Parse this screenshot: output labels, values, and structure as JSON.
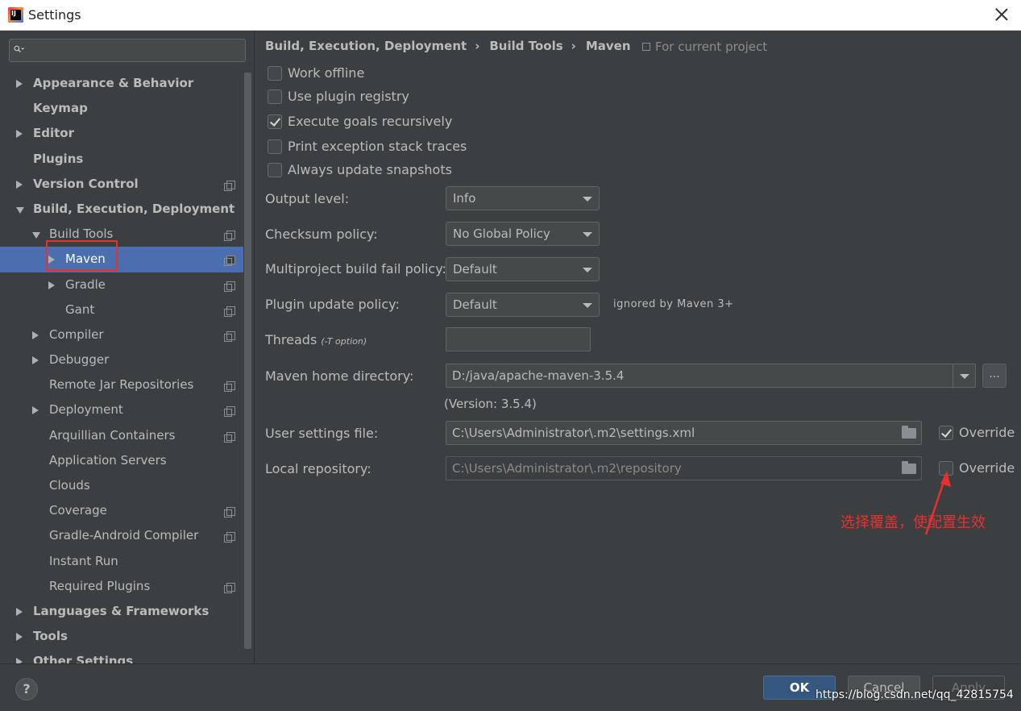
{
  "window": {
    "title": "Settings"
  },
  "sidebar": {
    "search_placeholder": "",
    "items": [
      {
        "label": "Appearance & Behavior",
        "bold": true,
        "arrow": "right",
        "indent": 0,
        "project": false
      },
      {
        "label": "Keymap",
        "bold": true,
        "arrow": "none",
        "indent": 0,
        "project": false
      },
      {
        "label": "Editor",
        "bold": true,
        "arrow": "right",
        "indent": 0,
        "project": false
      },
      {
        "label": "Plugins",
        "bold": true,
        "arrow": "none",
        "indent": 0,
        "project": false
      },
      {
        "label": "Version Control",
        "bold": true,
        "arrow": "right",
        "indent": 0,
        "project": true
      },
      {
        "label": "Build, Execution, Deployment",
        "bold": true,
        "arrow": "down",
        "indent": 0,
        "project": false
      },
      {
        "label": "Build Tools",
        "bold": false,
        "arrow": "down",
        "indent": 1,
        "project": true
      },
      {
        "label": "Maven",
        "bold": false,
        "arrow": "right",
        "indent": 2,
        "project": true,
        "selected": true
      },
      {
        "label": "Gradle",
        "bold": false,
        "arrow": "right",
        "indent": 2,
        "project": true
      },
      {
        "label": "Gant",
        "bold": false,
        "arrow": "none",
        "indent": 2,
        "project": true
      },
      {
        "label": "Compiler",
        "bold": false,
        "arrow": "right",
        "indent": 1,
        "project": true
      },
      {
        "label": "Debugger",
        "bold": false,
        "arrow": "right",
        "indent": 1,
        "project": false
      },
      {
        "label": "Remote Jar Repositories",
        "bold": false,
        "arrow": "none",
        "indent": 1,
        "project": true
      },
      {
        "label": "Deployment",
        "bold": false,
        "arrow": "right",
        "indent": 1,
        "project": true
      },
      {
        "label": "Arquillian Containers",
        "bold": false,
        "arrow": "none",
        "indent": 1,
        "project": true
      },
      {
        "label": "Application Servers",
        "bold": false,
        "arrow": "none",
        "indent": 1,
        "project": false
      },
      {
        "label": "Clouds",
        "bold": false,
        "arrow": "none",
        "indent": 1,
        "project": false
      },
      {
        "label": "Coverage",
        "bold": false,
        "arrow": "none",
        "indent": 1,
        "project": true
      },
      {
        "label": "Gradle-Android Compiler",
        "bold": false,
        "arrow": "none",
        "indent": 1,
        "project": true
      },
      {
        "label": "Instant Run",
        "bold": false,
        "arrow": "none",
        "indent": 1,
        "project": false
      },
      {
        "label": "Required Plugins",
        "bold": false,
        "arrow": "none",
        "indent": 1,
        "project": true
      },
      {
        "label": "Languages & Frameworks",
        "bold": true,
        "arrow": "right",
        "indent": 0,
        "project": false
      },
      {
        "label": "Tools",
        "bold": true,
        "arrow": "right",
        "indent": 0,
        "project": false
      },
      {
        "label": "Other Settings",
        "bold": true,
        "arrow": "right",
        "indent": 0,
        "project": false
      }
    ]
  },
  "main": {
    "breadcrumb": [
      "Build, Execution, Deployment",
      "Build Tools",
      "Maven"
    ],
    "breadcrumb_sep": "›",
    "for_current_project": "For current project",
    "checkboxes": [
      {
        "label": "Work offline",
        "checked": false
      },
      {
        "label": "Use plugin registry",
        "checked": false
      },
      {
        "label": "Execute goals recursively",
        "checked": true
      },
      {
        "label": "Print exception stack traces",
        "checked": false
      },
      {
        "label": "Always update snapshots",
        "checked": false
      }
    ],
    "output_level": {
      "label": "Output level:",
      "value": "Info"
    },
    "checksum_policy": {
      "label": "Checksum policy:",
      "value": "No Global Policy"
    },
    "multiproject_policy": {
      "label": "Multiproject build fail policy:",
      "value": "Default"
    },
    "plugin_update_policy": {
      "label": "Plugin update policy:",
      "value": "Default",
      "note": "ignored by Maven 3+"
    },
    "threads": {
      "label": "Threads",
      "hint": "(-T option)",
      "value": ""
    },
    "maven_home": {
      "label": "Maven home directory:",
      "value": "D:/java/apache-maven-3.5.4",
      "browse": "...",
      "version": "(Version: 3.5.4)"
    },
    "user_settings": {
      "label": "User settings file:",
      "value": "C:\\Users\\Administrator\\.m2\\settings.xml",
      "override_label": "Override",
      "override_checked": true
    },
    "local_repo": {
      "label": "Local repository:",
      "value": "C:\\Users\\Administrator\\.m2\\repository",
      "override_label": "Override",
      "override_checked": false
    },
    "annotation": "选择覆盖，使配置生效"
  },
  "footer": {
    "help": "?",
    "ok": "OK",
    "cancel": "Cancel",
    "apply": "Apply",
    "watermark": "https://blog.csdn.net/qq_42815754"
  },
  "colors": {
    "selected": "#4b6eaf",
    "annotation": "#e83030",
    "background": "#3c3f41"
  }
}
